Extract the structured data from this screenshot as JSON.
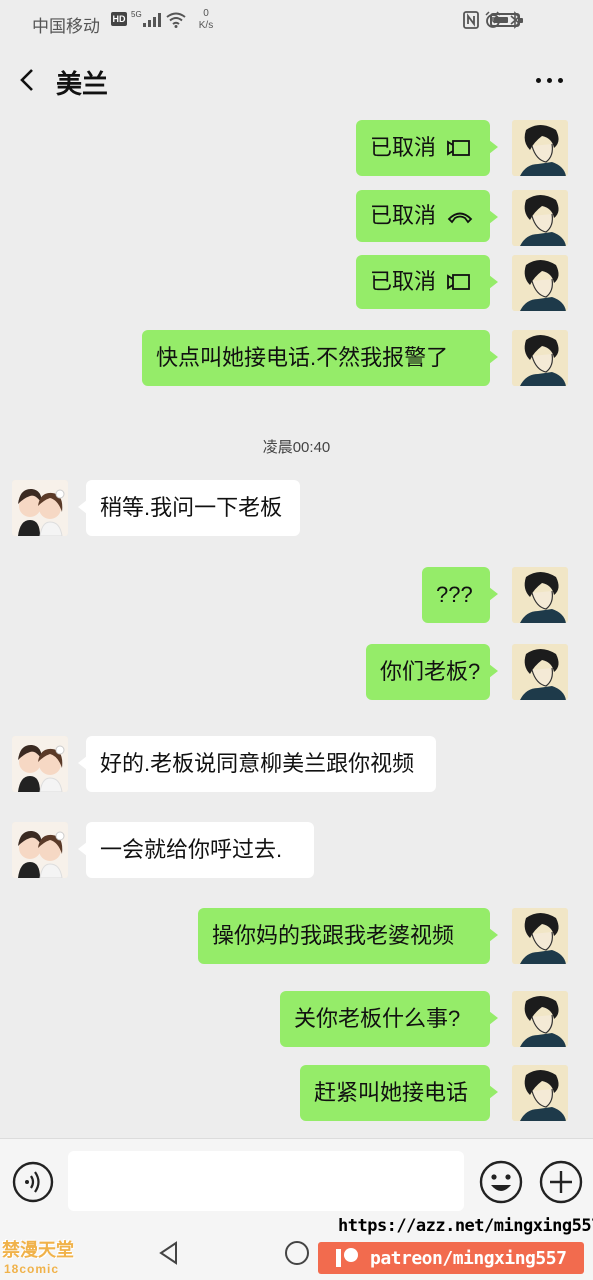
{
  "status_bar": {
    "carrier": "中国移动",
    "hd_badge": "HD",
    "network": "5G",
    "speed_value": "0",
    "speed_unit": "K/s"
  },
  "header": {
    "title": "美兰"
  },
  "messages": [
    {
      "side": "out",
      "text": "已取消",
      "icon": "video-call-icon"
    },
    {
      "side": "out",
      "text": "已取消",
      "icon": "phone-call-icon"
    },
    {
      "side": "out",
      "text": "已取消",
      "icon": "video-call-icon"
    },
    {
      "side": "out",
      "text": "快点叫她接电话.不然我报警了"
    },
    {
      "side": "in",
      "text": "稍等.我问一下老板"
    },
    {
      "side": "out",
      "text": "???"
    },
    {
      "side": "out",
      "text": "你们老板?"
    },
    {
      "side": "in",
      "text": "好的.老板说同意柳美兰跟你视频"
    },
    {
      "side": "in",
      "text": "一会就给你呼过去."
    },
    {
      "side": "out",
      "text": "操你妈的我跟我老婆视频"
    },
    {
      "side": "out",
      "text": "关你老板什么事?"
    },
    {
      "side": "out",
      "text": "赶紧叫她接电话"
    }
  ],
  "timestamp": "凌晨00:40",
  "input_bar": {
    "placeholder": ""
  },
  "watermark": {
    "url": "https://azz.net/mingxing557",
    "patreon": "patreon/mingxing557",
    "site": "禁漫天堂",
    "site_sub": "18comic"
  },
  "colors": {
    "background": "#ededed",
    "outgoing_bubble": "#95ec69",
    "incoming_bubble": "#ffffff"
  }
}
